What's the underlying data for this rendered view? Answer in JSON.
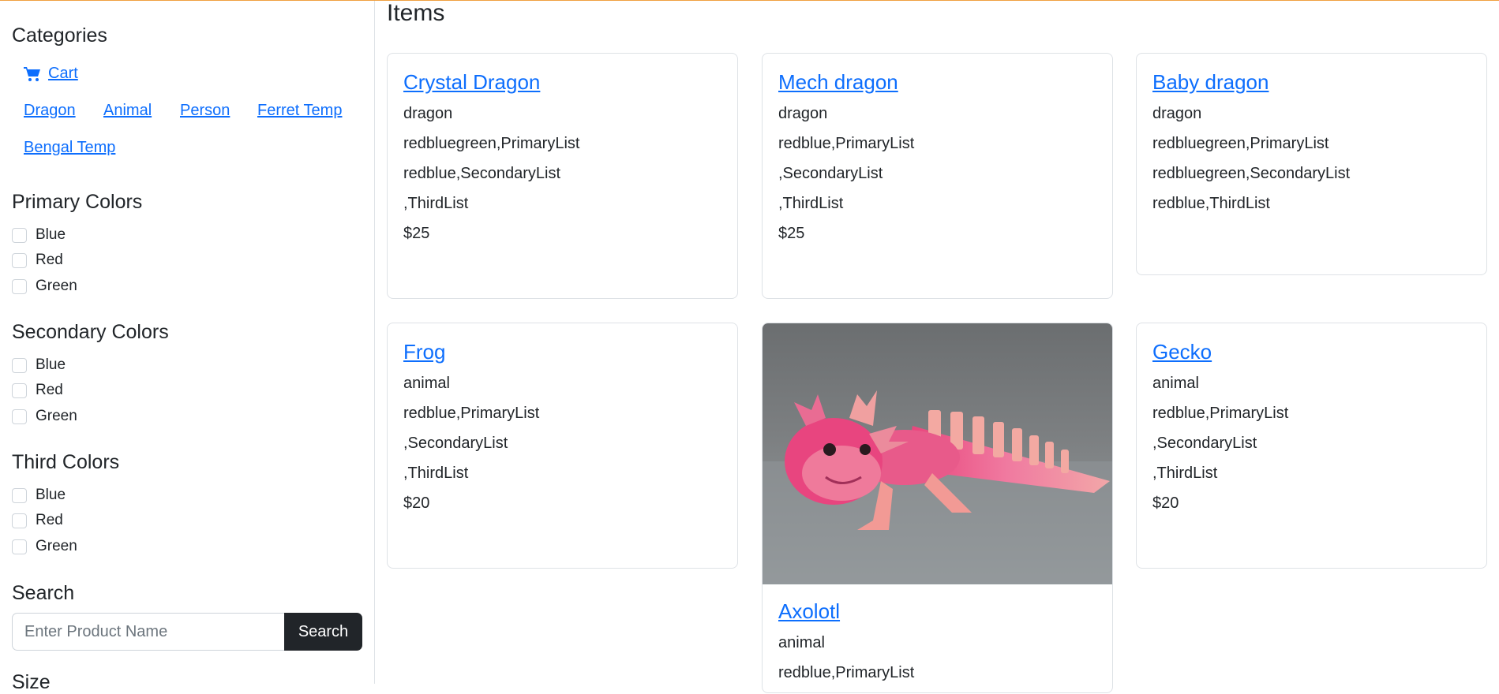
{
  "sidebar": {
    "categories_heading": "Categories",
    "cart_label": "Cart",
    "category_links": [
      "Dragon",
      "Animal",
      "Person",
      "Ferret Temp",
      "Bengal Temp"
    ],
    "primary_heading": "Primary Colors",
    "primary_colors": [
      "Blue",
      "Red",
      "Green"
    ],
    "secondary_heading": "Secondary Colors",
    "secondary_colors": [
      "Blue",
      "Red",
      "Green"
    ],
    "third_heading": "Third Colors",
    "third_colors": [
      "Blue",
      "Red",
      "Green"
    ],
    "search_heading": "Search",
    "search_placeholder": "Enter Product Name",
    "search_button": "Search",
    "size_heading": "Size"
  },
  "main": {
    "title": "Items",
    "cards": [
      {
        "name": "Crystal Dragon",
        "category": "dragon",
        "primary": "redbluegreen,PrimaryList",
        "secondary": "redblue,SecondaryList",
        "third": ",ThirdList",
        "price": "$25"
      },
      {
        "name": "Mech dragon",
        "category": "dragon",
        "primary": "redblue,PrimaryList",
        "secondary": ",SecondaryList",
        "third": ",ThirdList",
        "price": "$25"
      },
      {
        "name": "Baby dragon",
        "category": "dragon",
        "primary": "redbluegreen,PrimaryList",
        "secondary": "redbluegreen,SecondaryList",
        "third": "redblue,ThirdList",
        "price": ""
      },
      {
        "name": "Frog",
        "category": "animal",
        "primary": "redblue,PrimaryList",
        "secondary": ",SecondaryList",
        "third": ",ThirdList",
        "price": "$20"
      },
      {
        "name": "Axolotl",
        "category": "animal",
        "primary": "redblue,PrimaryList",
        "secondary": "",
        "third": "",
        "price": ""
      },
      {
        "name": "Gecko",
        "category": "animal",
        "primary": "redblue,PrimaryList",
        "secondary": ",SecondaryList",
        "third": ",ThirdList",
        "price": "$20"
      }
    ]
  },
  "colors": {
    "accent": "#0d6efd",
    "button_dark": "#212529",
    "top_border": "#f0a040"
  }
}
